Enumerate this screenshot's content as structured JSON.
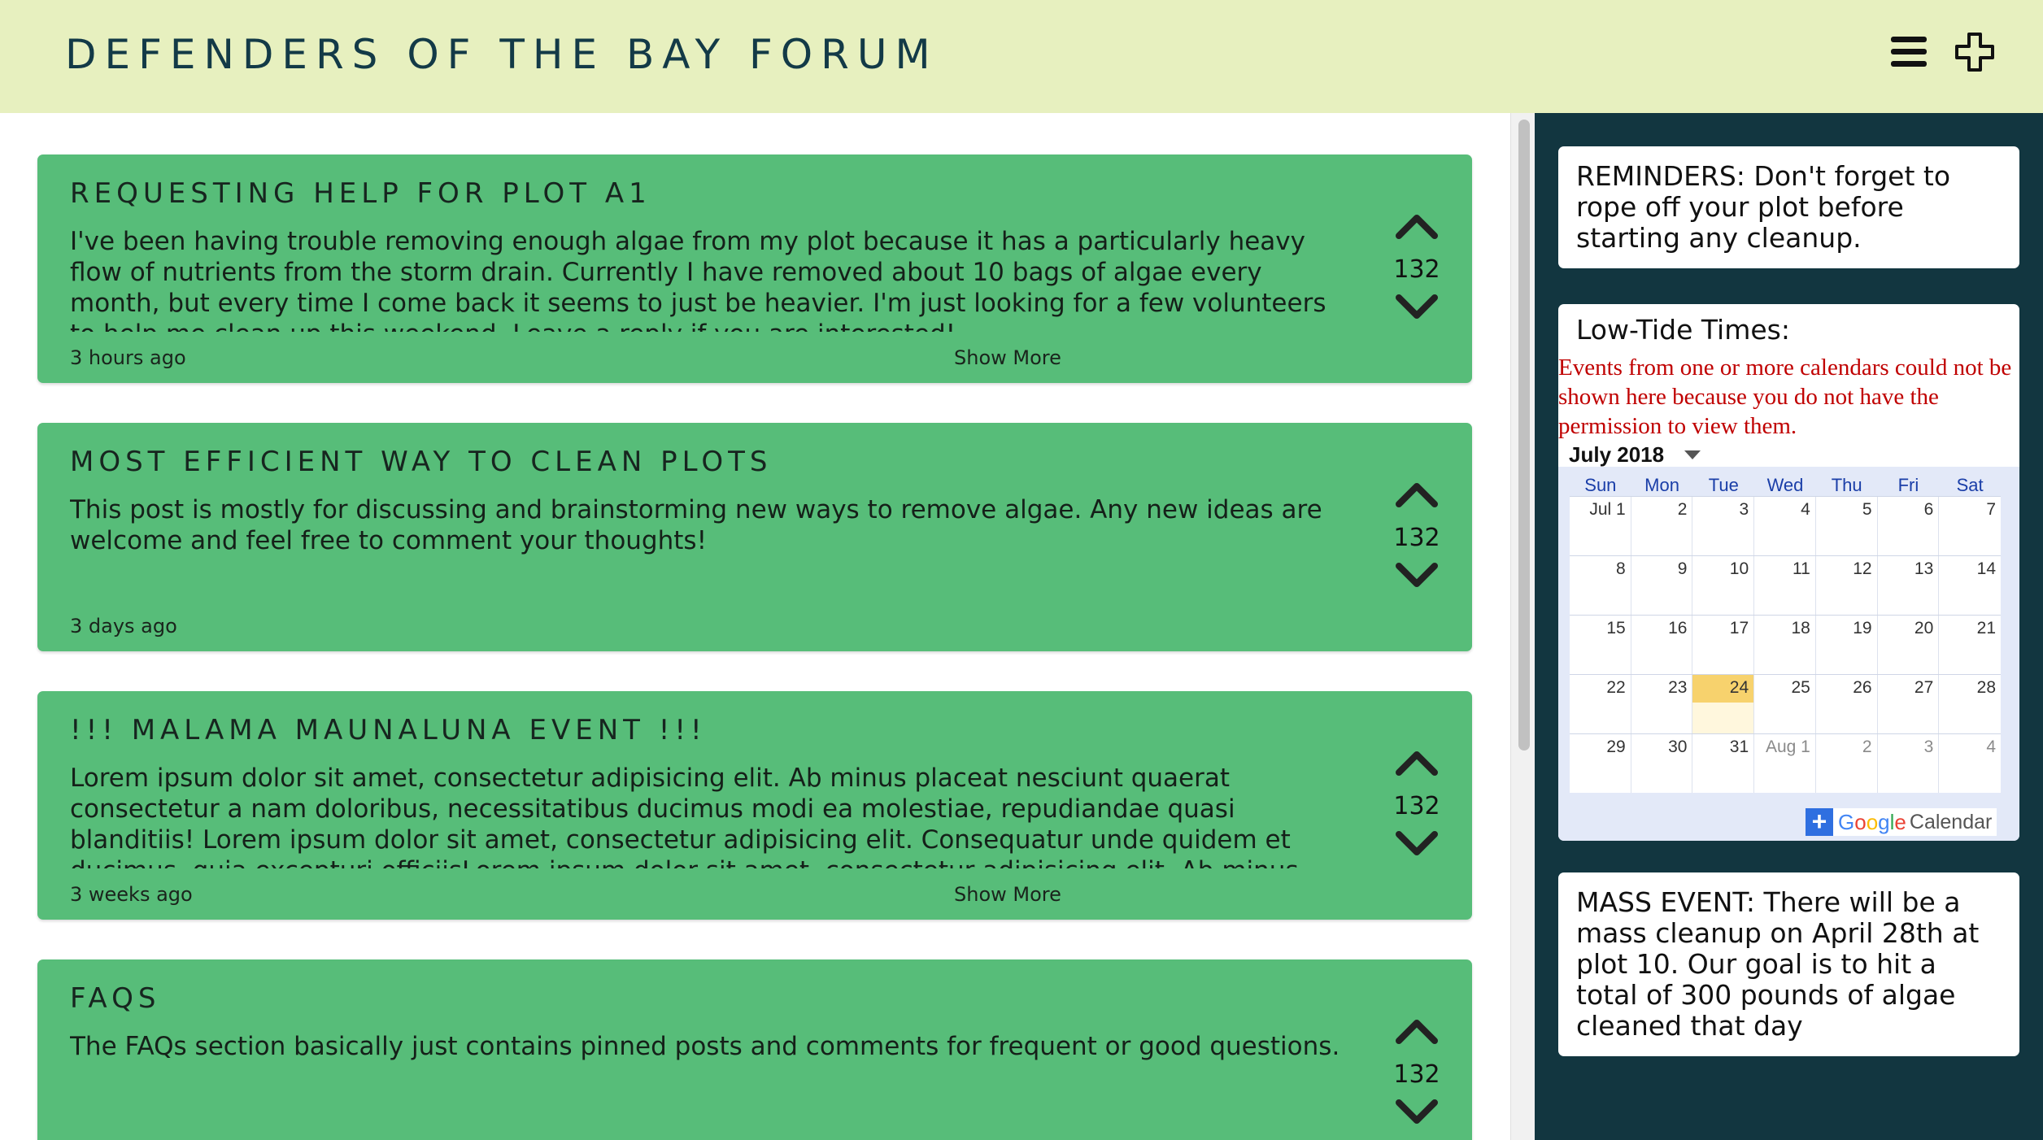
{
  "header": {
    "title": "DEFENDERS OF THE BAY FORUM",
    "menu_icon": "hamburger-menu-icon",
    "add_icon": "plus-outline-icon"
  },
  "posts": [
    {
      "title": "REQUESTING HELP FOR PLOT A1",
      "body": "I've been having trouble removing enough algae from my plot because it has a particularly heavy flow of nutrients from the storm drain. Currently I have removed about 10 bags of algae every month, but every time I come back it seems to just be heavier. I'm just looking for a few volunteers to help me clean up this weekend. Leave a reply if you are interested!",
      "time": "3 hours ago",
      "show_more": "Show More",
      "votes": "132"
    },
    {
      "title": "MOST EFFICIENT WAY TO CLEAN PLOTS",
      "body": "This post is mostly for discussing and brainstorming new ways to remove algae. Any new ideas are welcome and feel free to comment your thoughts!",
      "time": "3 days ago",
      "show_more": "",
      "votes": "132"
    },
    {
      "title": "!!! MALAMA MAUNALUNA EVENT !!!",
      "body": "Lorem ipsum dolor sit amet, consectetur adipisicing elit. Ab minus placeat nesciunt quaerat consectetur a nam doloribus, necessitatibus ducimus modi ea molestiae, repudiandae quasi blanditiis! Lorem ipsum dolor sit amet, consectetur adipisicing elit. Consequatur unde quidem et ducimus, quia excepturi officiisLorem ipsum dolor sit amet, consectetur adipisicing elit. Ab minus placeat nesciunt quaerat consectetur a nam",
      "time": "3 weeks ago",
      "show_more": "Show More",
      "votes": "132"
    },
    {
      "title": "FAQS",
      "body": "The FAQs section basically just contains pinned posts and comments for frequent or good questions.",
      "time": "",
      "show_more": "",
      "votes": "132"
    }
  ],
  "sidebar": {
    "reminders": {
      "label": "REMINDERS:",
      "text": " Don't forget to rope off your plot before starting any cleanup."
    },
    "calendar": {
      "heading": "Low-Tide Times:",
      "warning": "Events from one or more calendars could not be shown here because you do not have the permission to view them.",
      "month": "July 2018",
      "days_of_week": [
        "Sun",
        "Mon",
        "Tue",
        "Wed",
        "Thu",
        "Fri",
        "Sat"
      ],
      "weeks": [
        [
          "Jul 1",
          "2",
          "3",
          "4",
          "5",
          "6",
          "7"
        ],
        [
          "8",
          "9",
          "10",
          "11",
          "12",
          "13",
          "14"
        ],
        [
          "15",
          "16",
          "17",
          "18",
          "19",
          "20",
          "21"
        ],
        [
          "22",
          "23",
          "24",
          "25",
          "26",
          "27",
          "28"
        ],
        [
          "29",
          "30",
          "31",
          "Aug 1",
          "2",
          "3",
          "4"
        ]
      ],
      "today": "24",
      "badge_google": "Google",
      "badge_calendar": "Calendar",
      "badge_plus": "+"
    },
    "mass_event": {
      "label": "MASS EVENT:",
      "text": " There will be a mass cleanup on April 28th at plot 10. Our goal is to hit a total of 300 pounds of algae cleaned that day"
    }
  },
  "colors": {
    "header_bg": "#e7f0bf",
    "post_bg": "#57bd79",
    "sidebar_bg": "#123640",
    "warning_red": "#c00000",
    "today_highlight": "#f7d26d"
  }
}
